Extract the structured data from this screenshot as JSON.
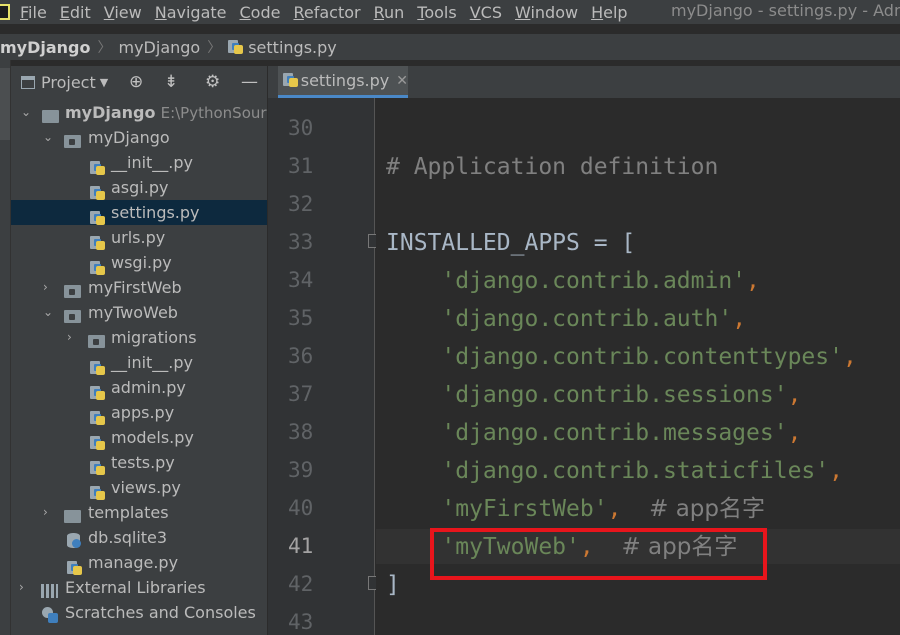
{
  "menubar": {
    "items": [
      "File",
      "Edit",
      "View",
      "Navigate",
      "Code",
      "Refactor",
      "Run",
      "Tools",
      "VCS",
      "Window",
      "Help"
    ],
    "window_title": "myDjango - settings.py - Adm"
  },
  "breadcrumbs": {
    "items": [
      "myDjango",
      "myDjango",
      "settings.py"
    ]
  },
  "project_panel": {
    "title": "Project"
  },
  "tree": [
    {
      "label": "myDjango",
      "suffix": "E:\\PythonSour",
      "arrow": "down",
      "icon": "folder",
      "depth": 0,
      "bold": true
    },
    {
      "label": "myDjango",
      "arrow": "down",
      "icon": "module",
      "depth": 1
    },
    {
      "label": "__init__.py",
      "icon": "py",
      "depth": 2
    },
    {
      "label": "asgi.py",
      "icon": "py",
      "depth": 2
    },
    {
      "label": "settings.py",
      "icon": "py",
      "depth": 2,
      "selected": true
    },
    {
      "label": "urls.py",
      "icon": "py",
      "depth": 2
    },
    {
      "label": "wsgi.py",
      "icon": "py",
      "depth": 2
    },
    {
      "label": "myFirstWeb",
      "arrow": "right",
      "icon": "module",
      "depth": 1
    },
    {
      "label": "myTwoWeb",
      "arrow": "down",
      "icon": "module",
      "depth": 1
    },
    {
      "label": "migrations",
      "arrow": "right",
      "icon": "module",
      "depth": 2
    },
    {
      "label": "__init__.py",
      "icon": "py",
      "depth": 2
    },
    {
      "label": "admin.py",
      "icon": "py",
      "depth": 2
    },
    {
      "label": "apps.py",
      "icon": "py",
      "depth": 2
    },
    {
      "label": "models.py",
      "icon": "py",
      "depth": 2
    },
    {
      "label": "tests.py",
      "icon": "py",
      "depth": 2
    },
    {
      "label": "views.py",
      "icon": "py",
      "depth": 2
    },
    {
      "label": "templates",
      "arrow": "right",
      "icon": "folder",
      "depth": 1
    },
    {
      "label": "db.sqlite3",
      "icon": "db",
      "depth": 1
    },
    {
      "label": "manage.py",
      "icon": "py",
      "depth": 1
    },
    {
      "label": "External Libraries",
      "arrow": "right",
      "icon": "lib",
      "depth": 0
    },
    {
      "label": "Scratches and Consoles",
      "icon": "scratch",
      "depth": 0
    }
  ],
  "editor": {
    "tab_label": "settings.py",
    "line_numbers": [
      "30",
      "31",
      "32",
      "33",
      "34",
      "35",
      "36",
      "37",
      "38",
      "39",
      "40",
      "41",
      "42",
      "43"
    ],
    "current_line": "41",
    "code": {
      "l31": "# Application definition",
      "l33_name": "INSTALLED_APPS",
      "l33_rest": " = [",
      "apps": [
        "'django.contrib.admin'",
        "'django.contrib.auth'",
        "'django.contrib.contenttypes'",
        "'django.contrib.sessions'",
        "'django.contrib.messages'",
        "'django.contrib.staticfiles'"
      ],
      "l40_str": "'myFirstWeb'",
      "l40_comment": "# app名字",
      "l41_str": "'myTwoWeb'",
      "l41_comment": "# app名字",
      "l42": "]",
      "comma": ","
    }
  },
  "colors": {
    "highlight_box": "#e8151c",
    "selection": "#0d293e",
    "string": "#6a8759",
    "keyword": "#cc7832",
    "comment": "#808080"
  }
}
